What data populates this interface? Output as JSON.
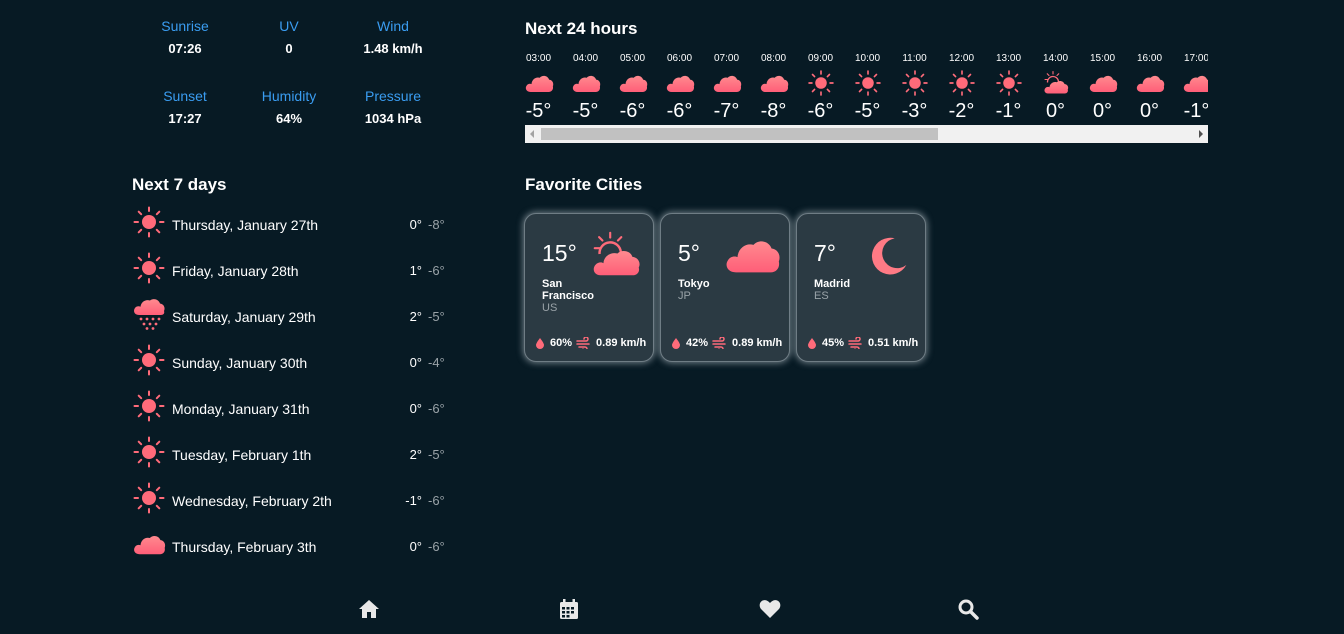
{
  "stats": {
    "sunrise": {
      "label": "Sunrise",
      "value": "07:26"
    },
    "uv": {
      "label": "UV",
      "value": "0"
    },
    "wind": {
      "label": "Wind",
      "value": "1.48 km/h"
    },
    "sunset": {
      "label": "Sunset",
      "value": "17:27"
    },
    "humidity": {
      "label": "Humidity",
      "value": "64%"
    },
    "pressure": {
      "label": "Pressure",
      "value": "1034 hPa"
    }
  },
  "next7": {
    "title": "Next 7 days",
    "days": [
      {
        "name": "Thursday, January 27th",
        "hi": "0°",
        "lo": "-8°",
        "icon": "sun-icon"
      },
      {
        "name": "Friday, January 28th",
        "hi": "1°",
        "lo": "-6°",
        "icon": "sun-icon"
      },
      {
        "name": "Saturday, January 29th",
        "hi": "2°",
        "lo": "-5°",
        "icon": "snow-cloud-icon"
      },
      {
        "name": "Sunday, January 30th",
        "hi": "0°",
        "lo": "-4°",
        "icon": "sun-icon"
      },
      {
        "name": "Monday, January 31th",
        "hi": "0°",
        "lo": "-6°",
        "icon": "sun-icon"
      },
      {
        "name": "Tuesday, February 1th",
        "hi": "2°",
        "lo": "-5°",
        "icon": "sun-icon"
      },
      {
        "name": "Wednesday, February 2th",
        "hi": "-1°",
        "lo": "-6°",
        "icon": "sun-icon"
      },
      {
        "name": "Thursday, February 3th",
        "hi": "0°",
        "lo": "-6°",
        "icon": "cloud-icon"
      }
    ]
  },
  "next24": {
    "title": "Next 24 hours",
    "hours": [
      {
        "time": "03:00",
        "temp": "-5°",
        "icon": "cloud-icon"
      },
      {
        "time": "04:00",
        "temp": "-5°",
        "icon": "cloud-icon"
      },
      {
        "time": "05:00",
        "temp": "-6°",
        "icon": "cloud-icon"
      },
      {
        "time": "06:00",
        "temp": "-6°",
        "icon": "cloud-icon"
      },
      {
        "time": "07:00",
        "temp": "-7°",
        "icon": "cloud-icon"
      },
      {
        "time": "08:00",
        "temp": "-8°",
        "icon": "cloud-icon"
      },
      {
        "time": "09:00",
        "temp": "-6°",
        "icon": "sun-icon"
      },
      {
        "time": "10:00",
        "temp": "-5°",
        "icon": "sun-icon"
      },
      {
        "time": "11:00",
        "temp": "-3°",
        "icon": "sun-icon"
      },
      {
        "time": "12:00",
        "temp": "-2°",
        "icon": "sun-icon"
      },
      {
        "time": "13:00",
        "temp": "-1°",
        "icon": "sun-icon"
      },
      {
        "time": "14:00",
        "temp": "0°",
        "icon": "partly-cloudy-icon"
      },
      {
        "time": "15:00",
        "temp": "0°",
        "icon": "cloud-icon"
      },
      {
        "time": "16:00",
        "temp": "0°",
        "icon": "cloud-icon"
      },
      {
        "time": "17:00",
        "temp": "-1°",
        "icon": "cloud-icon"
      }
    ]
  },
  "favorites": {
    "title": "Favorite Cities",
    "cities": [
      {
        "temp": "15°",
        "name": "San Francisco",
        "country": "US",
        "humidity": "60%",
        "wind": "0.89 km/h",
        "icon": "partly-cloudy-icon"
      },
      {
        "temp": "5°",
        "name": "Tokyo",
        "country": "JP",
        "humidity": "42%",
        "wind": "0.89 km/h",
        "icon": "cloud-icon"
      },
      {
        "temp": "7°",
        "name": "Madrid",
        "country": "ES",
        "humidity": "45%",
        "wind": "0.51 km/h",
        "icon": "moon-icon"
      }
    ]
  },
  "nav": [
    "home-icon",
    "calendar-icon",
    "heart-icon",
    "search-icon"
  ],
  "colors": {
    "background": "#071a24",
    "accent": "#3a9cf0",
    "icon": "#ff6b7a",
    "card": "#2b3a43"
  }
}
